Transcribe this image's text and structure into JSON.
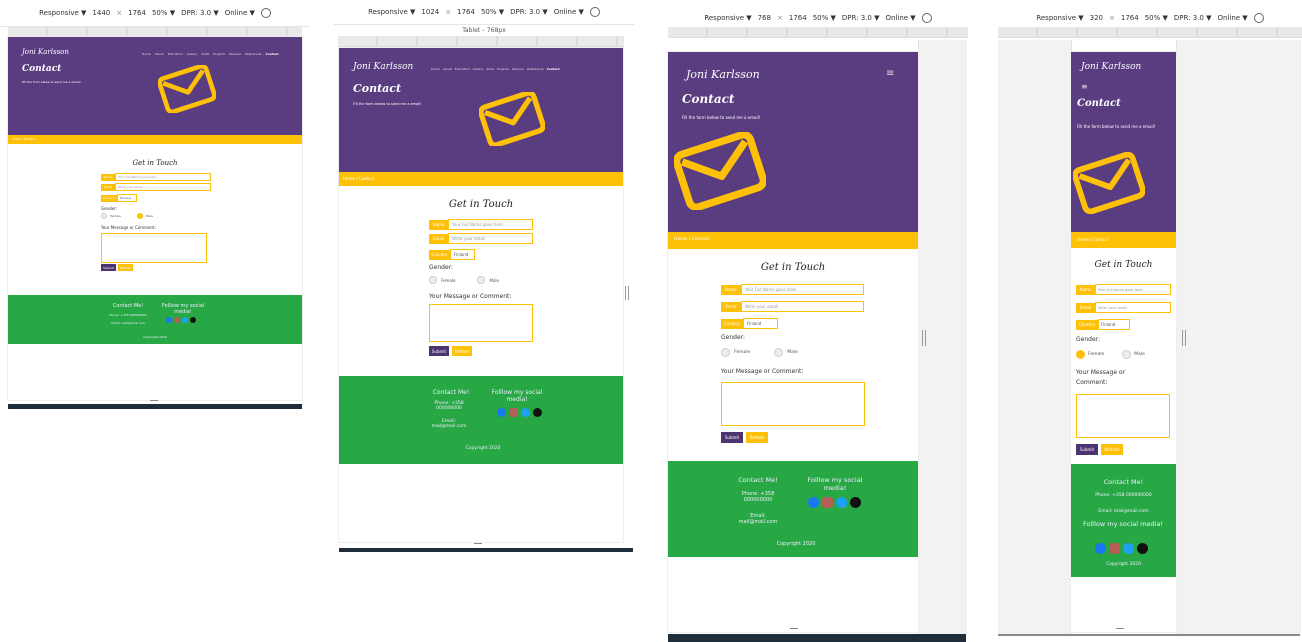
{
  "site": {
    "brand": "Joni Karlsson",
    "heading": "Contact",
    "subtitle": "Fill the form below to send me a email!",
    "nav": [
      "Home",
      "About",
      "Education",
      "Gallery",
      "Skills",
      "Projects",
      "Resume",
      "References",
      "Contact"
    ],
    "breadcrumb": "Home / Contact",
    "form_title": "Get in Touch",
    "name_label": "Name",
    "name_placeholder": "Your Full Name goes here",
    "email_label": "Email",
    "email_placeholder": "Write your email",
    "country_label": "Country",
    "country_value": "Finland",
    "gender_label": "Gender:",
    "female": "Female",
    "male": "Male",
    "message_label": "Your Message or Comment:",
    "submit": "Submit",
    "reset": "Refresh",
    "footer_contact_title": "Contact Me!",
    "footer_phone": "Phone: +358 000000000",
    "footer_email": "Email: mail@mail.com",
    "footer_social_title": "Folllow my social media!",
    "footer_copyright": "Copyright 2020"
  },
  "toolbars": [
    {
      "mode": "Responsive ▼",
      "width": "1440",
      "height": "1764",
      "zoom": "50% ▼",
      "dpr": "DPR: 3.0 ▼",
      "network": "Online ▼"
    },
    {
      "mode": "Responsive ▼",
      "width": "1024",
      "height": "1764",
      "zoom": "50% ▼",
      "dpr": "DPR: 3.0 ▼",
      "network": "Online ▼",
      "device_label": "Tablet – 768px"
    },
    {
      "mode": "Responsive ▼",
      "width": "768",
      "height": "1764",
      "zoom": "50% ▼",
      "dpr": "DPR: 3.0 ▼",
      "network": "Online ▼"
    },
    {
      "mode": "Responsive ▼",
      "width": "320",
      "height": "1764",
      "zoom": "50% ▼",
      "dpr": "DPR: 3.0 ▼",
      "network": "Online ▼"
    }
  ],
  "colors": {
    "purple": "#5a3d80",
    "yellow": "#ffc107",
    "green": "#28a745",
    "submit": "#4b3470"
  },
  "icons": [
    "envelope-icon",
    "hamburger-icon",
    "facebook-icon",
    "instagram-icon",
    "twitter-icon",
    "github-icon",
    "rotate-icon"
  ],
  "selected_gender": [
    "male",
    "male",
    "none",
    "female"
  ]
}
